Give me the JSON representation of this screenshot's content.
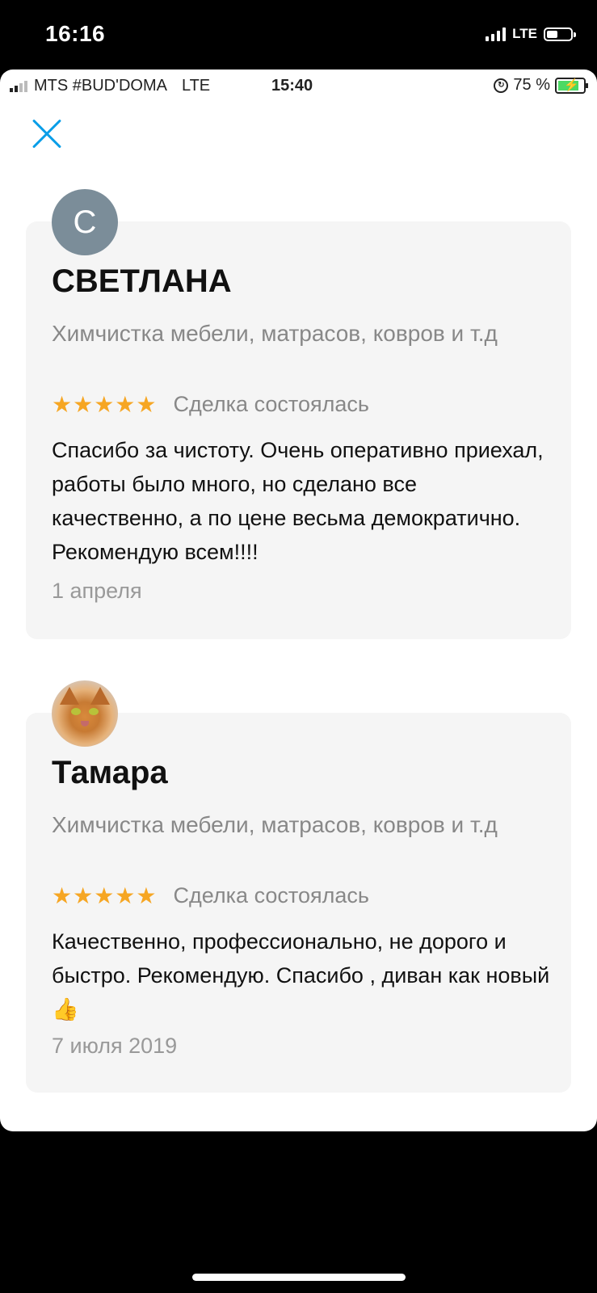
{
  "outer_status": {
    "time": "16:16",
    "network": "LTE"
  },
  "inner_status": {
    "carrier": "MTS #BUD'DOMA",
    "network": "LTE",
    "time": "15:40",
    "battery": "75 %"
  },
  "close_icon": "close-icon",
  "reviews": [
    {
      "avatar_letter": "С",
      "name": "СВЕТЛАНА",
      "category": "Химчистка мебели, матрасов, ковров и т.д",
      "stars": "★★★★★",
      "rating": 5,
      "deal_status": "Сделка состоялась",
      "text": "Спасибо за чистоту. Очень оперативно приехал, работы было много, но сделано все качественно, а по цене весьма демократично. Рекомендую всем!!!!",
      "date": "1 апреля"
    },
    {
      "avatar_icon": "cat-photo",
      "name": "Тамара",
      "category": "Химчистка мебели, матрасов, ковров и т.д",
      "stars": "★★★★★",
      "rating": 5,
      "deal_status": "Сделка состоялась",
      "text": "Качественно, профессионально, не дорого и быстро. Рекомендую. Спасибо , диван как новый👍",
      "date": "7 июля 2019"
    }
  ],
  "colors": {
    "accent": "#0a9ee8",
    "star": "#f6a623",
    "card_bg": "#f5f5f5",
    "avatar_bg": "#7b8d99"
  }
}
